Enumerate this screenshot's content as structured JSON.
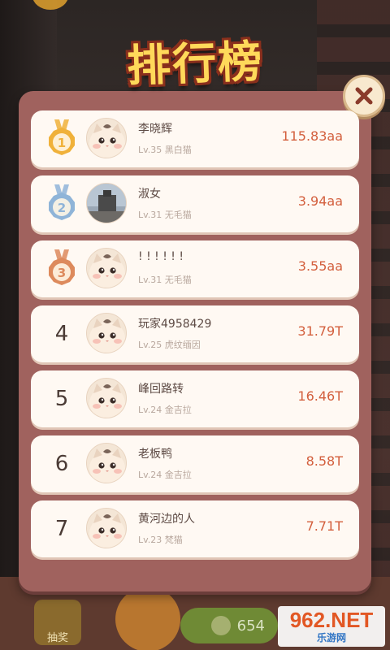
{
  "title": "排行榜",
  "ranking": [
    {
      "rank": "1",
      "medal": "gold",
      "name": "李晓辉",
      "level": "Lv.35 黑白猫",
      "score": "115.83aa",
      "avatar": "cat"
    },
    {
      "rank": "2",
      "medal": "silver",
      "name": "淑女",
      "level": "Lv.31 无毛猫",
      "score": "3.94aa",
      "avatar": "photo"
    },
    {
      "rank": "3",
      "medal": "bronze",
      "name": "! ! ! ! ! !",
      "level": "Lv.31 无毛猫",
      "score": "3.55aa",
      "avatar": "cat"
    },
    {
      "rank": "4",
      "medal": "",
      "name": "玩家4958429",
      "level": "Lv.25 虎纹缅因",
      "score": "31.79T",
      "avatar": "cat"
    },
    {
      "rank": "5",
      "medal": "",
      "name": "峰回路转",
      "level": "Lv.24 金吉拉",
      "score": "16.46T",
      "avatar": "cat"
    },
    {
      "rank": "6",
      "medal": "",
      "name": "老板鸭",
      "level": "Lv.24 金吉拉",
      "score": "8.58T",
      "avatar": "cat"
    },
    {
      "rank": "7",
      "medal": "",
      "name": "黄河边的人",
      "level": "Lv.23 梵猫",
      "score": "7.71T",
      "avatar": "cat"
    }
  ],
  "bottom": {
    "left_button": "抽奖",
    "cost": "654"
  },
  "watermark": {
    "number": "962.NET",
    "text": "乐游网"
  },
  "colors": {
    "panel": "#a0625e",
    "row": "#fff9f3",
    "score": "#d35f3d",
    "gold": "#f0b13a",
    "silver": "#8fb4d8",
    "bronze": "#dd8a5c"
  },
  "icons": {
    "close": "close-icon",
    "medal": "medal-icon",
    "coin": "coin-icon"
  }
}
